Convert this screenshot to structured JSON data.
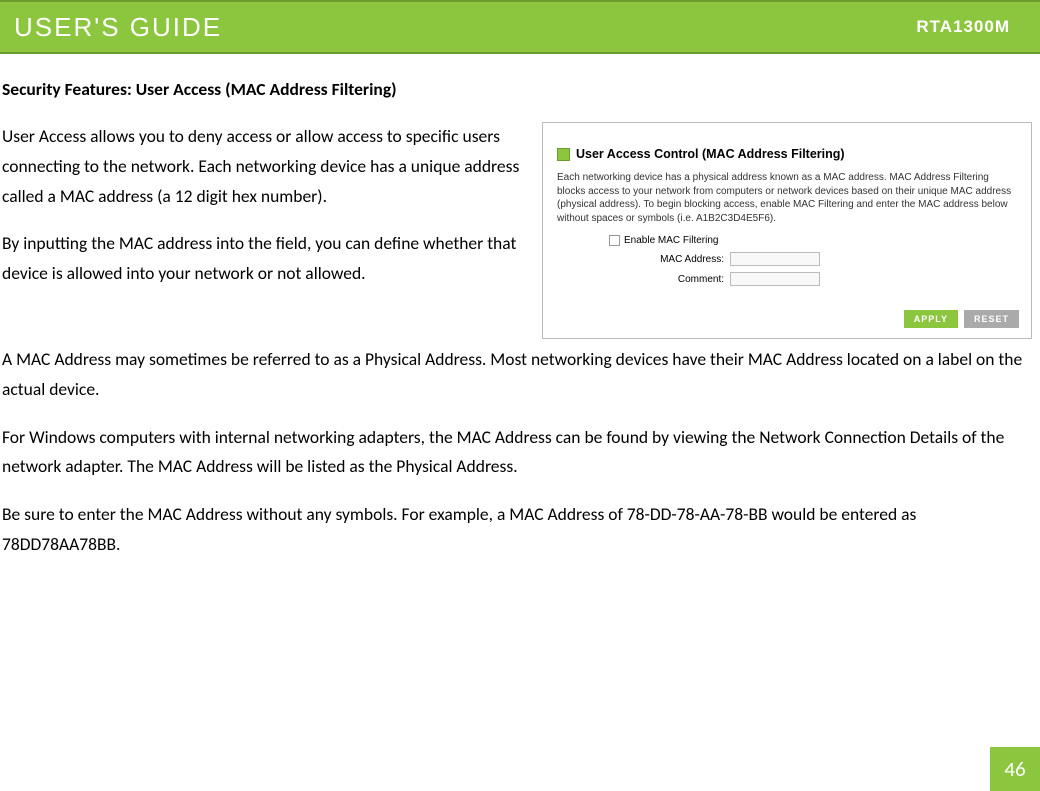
{
  "header": {
    "title": "USER'S GUIDE",
    "model": "RTA1300M"
  },
  "section_heading": "Security Features: User Access (MAC Address Filtering)",
  "paragraphs": {
    "p1": "User Access allows you to deny access or allow access to specific users connecting to the network.  Each networking device has a unique address called a MAC address (a 12 digit hex number).",
    "p2": "By inputting the MAC address into the field, you can define whether that device is allowed into your network or not allowed.",
    "p3": "A MAC Address may sometimes be referred to as a Physical Address.  Most networking devices have their MAC Address located on a label on the actual device.",
    "p4": "For Windows computers with internal networking adapters, the MAC Address can be found by viewing the Network Connection Details of the network adapter.  The MAC Address will be listed as the Physical Address.",
    "p5": "Be sure to enter the MAC Address without any symbols.  For example, a MAC Address of 78-DD-78-AA-78-BB would be entered as 78DD78AA78BB."
  },
  "panel": {
    "title": "User Access Control (MAC Address Filtering)",
    "desc": "Each networking device has a physical address known as a MAC address. MAC Address Filtering blocks access to your network from computers or network devices based on their unique MAC address (physical address). To begin blocking access, enable MAC Filtering and enter the MAC address below without spaces or symbols (i.e. A1B2C3D4E5F6).",
    "enable_label": "Enable MAC Filtering",
    "mac_label": "MAC Address:",
    "comment_label": "Comment:",
    "apply": "APPLY",
    "reset": "RESET"
  },
  "page_number": "46"
}
